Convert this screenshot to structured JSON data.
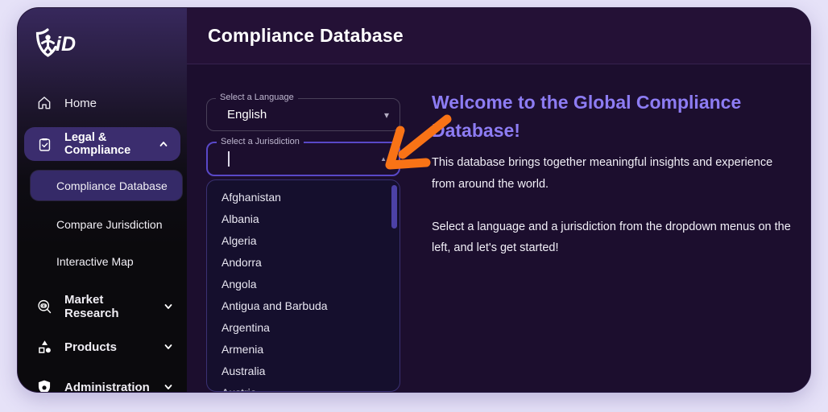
{
  "header": {
    "title": "Compliance Database"
  },
  "sidebar": {
    "logo": "KID",
    "home_label": "Home",
    "legal_label": "Legal & Compliance",
    "submenu": [
      "Compliance Database",
      "Compare Jurisdiction",
      "Interactive Map"
    ],
    "market_label": "Market Research",
    "products_label": "Products",
    "admin_label": "Administration"
  },
  "language_field": {
    "label": "Select a Language",
    "value": "English"
  },
  "jurisdiction_field": {
    "label": "Select a Jurisdiction",
    "value": ""
  },
  "jurisdiction_list": {
    "options": [
      "Afghanistan",
      "Albania",
      "Algeria",
      "Andorra",
      "Angola",
      "Antigua and Barbuda",
      "Argentina",
      "Armenia",
      "Australia",
      "Austria"
    ]
  },
  "welcome": {
    "heading": "Welcome to the Global Compliance Database!",
    "paragraph1": "This database brings together meaningful insights and experience from around the world.",
    "paragraph2": "Select a language and a jurisdiction from the dropdown menus on the left, and let's get started!"
  },
  "colors": {
    "accent_heading": "#8d7cf3",
    "arrow_annotation": "#f97316",
    "active_nav": "#3b2d6e",
    "focus_border": "#5948c8"
  }
}
